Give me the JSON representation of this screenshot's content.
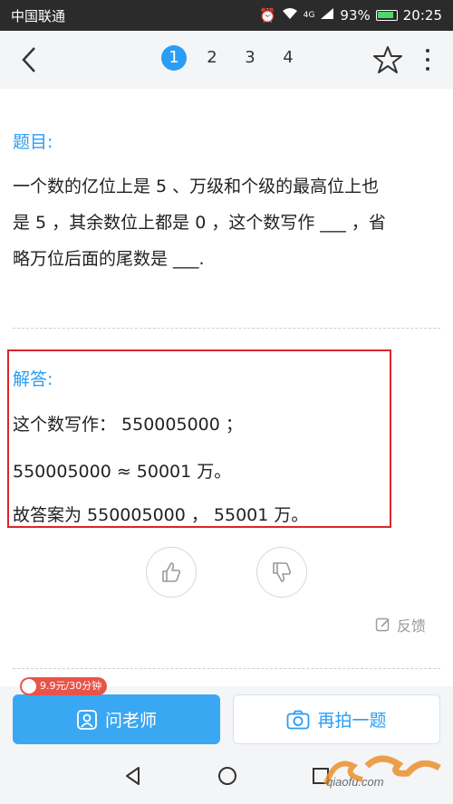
{
  "status_bar": {
    "carrier": "中国联通",
    "network": "4G",
    "battery": "93%",
    "time": "20:25"
  },
  "nav": {
    "pages": [
      "1",
      "2",
      "3",
      "4"
    ],
    "active_page": "1"
  },
  "question": {
    "label": "题目:",
    "lines": [
      "一个数的亿位上是 5 、万级和个级的最高位上也",
      "是 5 ，其余数位上都是 0 ，这个数写作 ___ ，省",
      "略万位后面的尾数是 ___."
    ]
  },
  "answer": {
    "label": "解答:",
    "lines": [
      "这个数写作：  550005000 ；",
      " 550005000 ≈ 50001 万。",
      "故答案为 550005000 ，  55001 万。"
    ]
  },
  "feedback_label": "反馈",
  "bottom": {
    "ask_teacher": "问老师",
    "retake": "再拍一题",
    "promo": "9.9元/30分钟"
  },
  "watermark": "qiaofu.com"
}
